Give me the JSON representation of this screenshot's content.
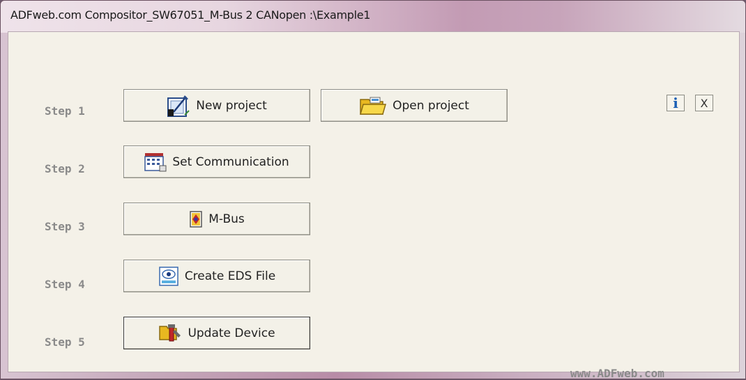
{
  "window": {
    "title": "ADFweb.com Compositor_SW67051_M-Bus 2 CANopen :\\Example1"
  },
  "toolbar": {
    "info_label": "i",
    "close_label": "X"
  },
  "steps": [
    {
      "label": "Step 1"
    },
    {
      "label": "Step 2"
    },
    {
      "label": "Step 3"
    },
    {
      "label": "Step 4"
    },
    {
      "label": "Step 5"
    }
  ],
  "buttons": {
    "new_project": "New project",
    "open_project": "Open project",
    "set_communication": "Set Communication",
    "mbus": "M-Bus",
    "create_eds": "Create EDS File",
    "update_device": "Update Device"
  },
  "icons": {
    "new_project": "new-project-icon",
    "open_project": "folder-icon",
    "set_communication": "communication-icon",
    "mbus": "mbus-icon",
    "create_eds": "eds-file-icon",
    "update_device": "update-device-icon"
  },
  "footer": {
    "url": "www.ADFweb.com"
  }
}
